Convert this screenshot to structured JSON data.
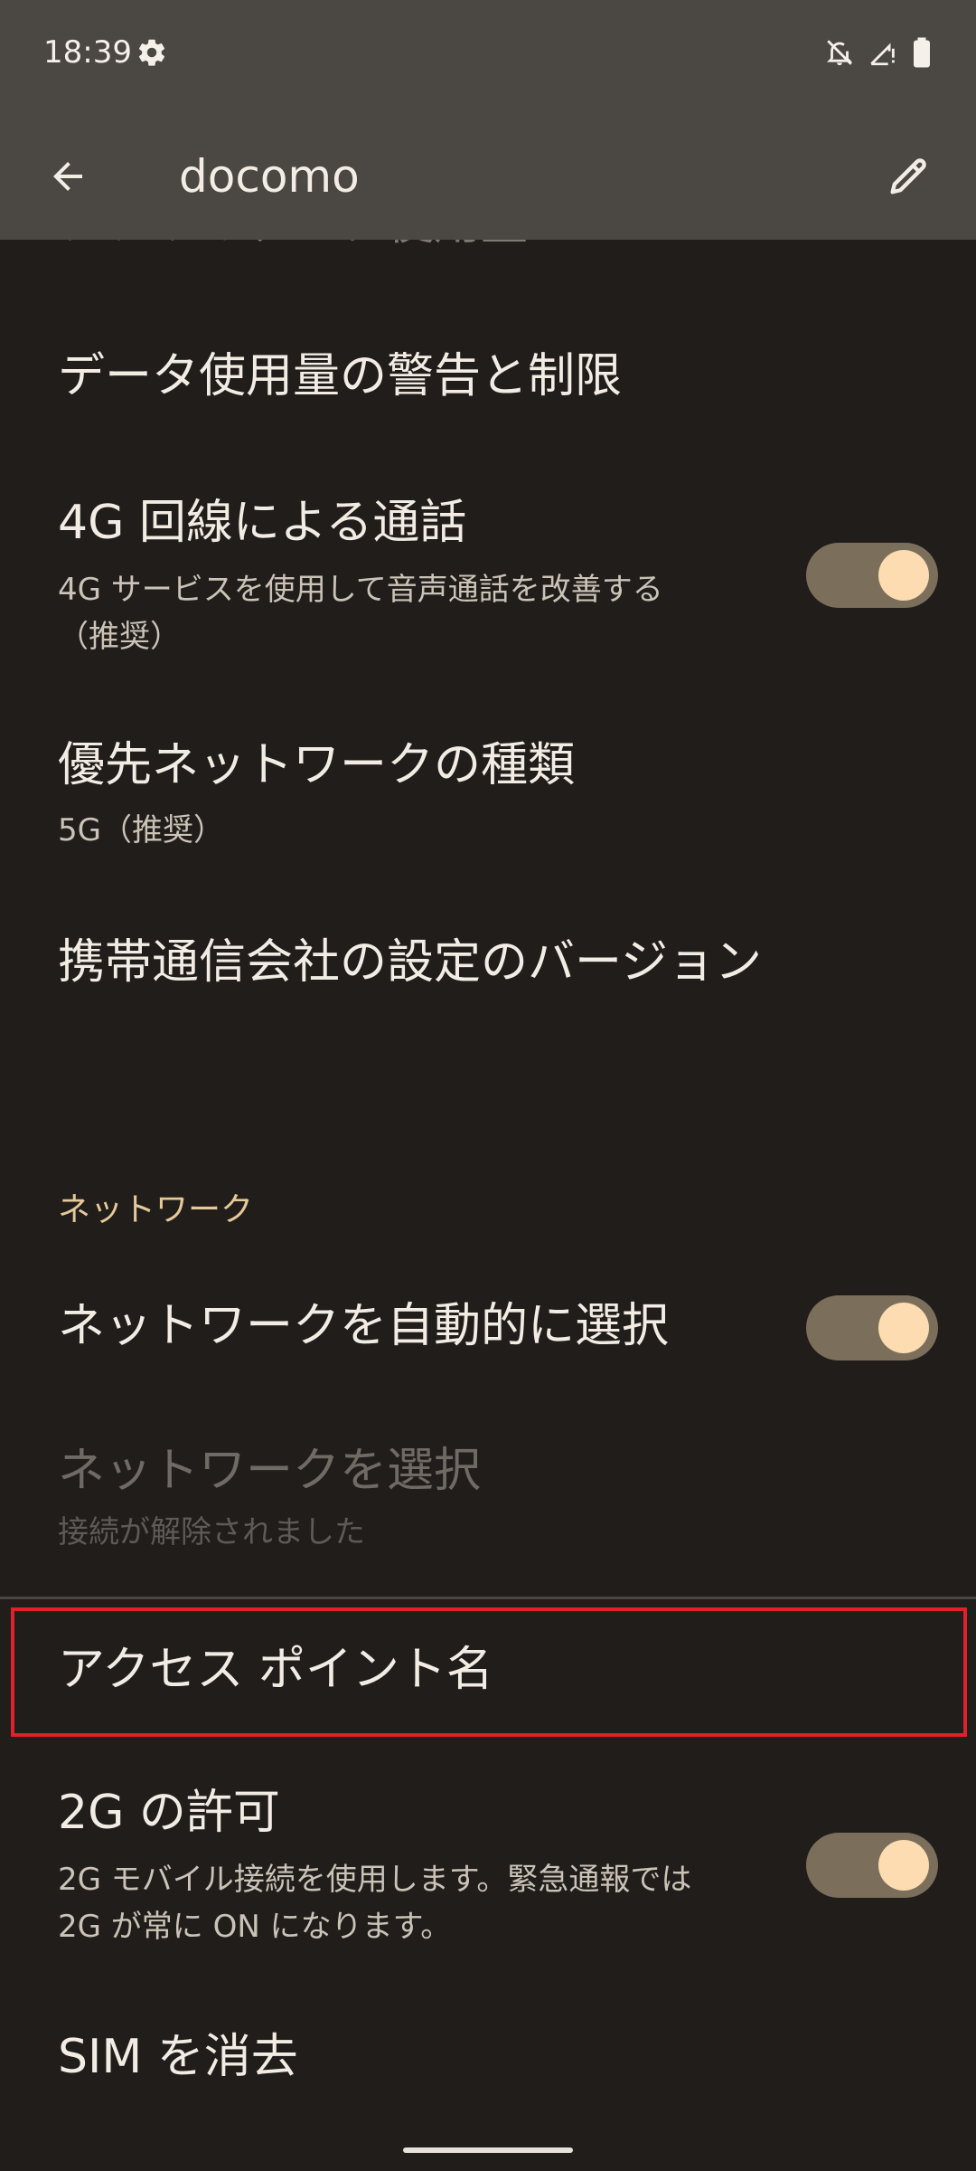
{
  "status_bar": {
    "time": "18:39",
    "icons": [
      "settings-gear-icon",
      "notifications-off-icon",
      "signal-alert-icon",
      "battery-icon"
    ]
  },
  "toolbar": {
    "title": "docomo",
    "back_icon": "arrow-back-icon",
    "edit_icon": "edit-pencil-icon"
  },
  "partial_item": {
    "title": "アプリのデータ使用量"
  },
  "items": {
    "data_warning": {
      "title": "データ使用量の警告と制限"
    },
    "volte": {
      "title": "4G 回線による通話",
      "summary_line1": "4G サービスを使用して音声通話を改善する",
      "summary_line2": "（推奨）",
      "toggle_on": true
    },
    "preferred_network": {
      "title": "優先ネットワークの種類",
      "summary": "5G（推奨）"
    },
    "carrier_version": {
      "title": "携帯通信会社の設定のバージョン"
    },
    "network_section": {
      "header": "ネットワーク"
    },
    "auto_select": {
      "title": "ネットワークを自動的に選択",
      "toggle_on": true
    },
    "select_network": {
      "title": "ネットワークを選択",
      "summary": "接続が解除されました",
      "enabled": false
    },
    "apn": {
      "title": "アクセス ポイント名"
    },
    "allow_2g": {
      "title": "2G の許可",
      "summary_line1": "2G モバイル接続を使用します。緊急通報では",
      "summary_line2": "2G が常に ON になります。",
      "toggle_on": true
    },
    "erase_sim": {
      "title": "SIM を消去"
    }
  },
  "colors": {
    "background": "#201d1a",
    "app_bar": "#4b4743",
    "accent_header": "#e5c99a",
    "toggle_track": "#7b6f5c",
    "toggle_knob": "#fcdcb0",
    "highlight": "#e0202a"
  }
}
